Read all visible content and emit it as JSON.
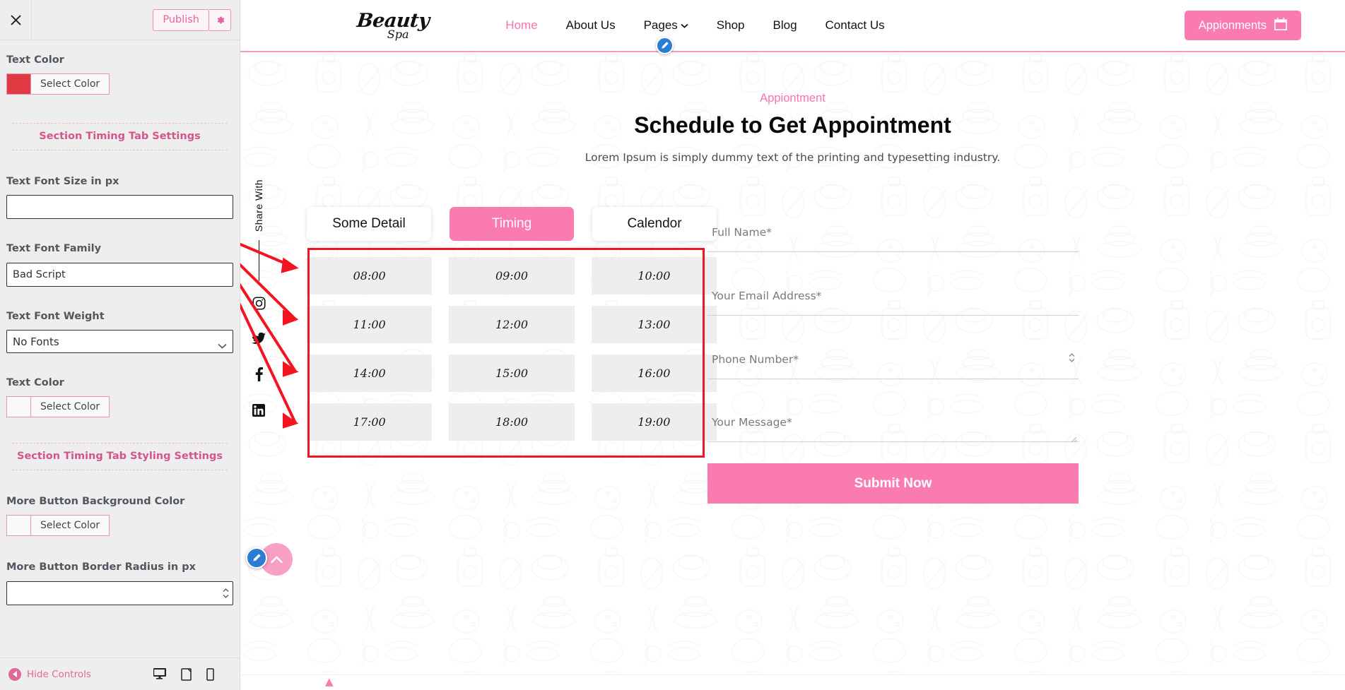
{
  "sidebar": {
    "close_icon": "close-icon",
    "publish_label": "Publish",
    "gear_icon": "gear-icon",
    "controls": [
      {
        "type": "color",
        "label": "Text Color",
        "swatch": "#e03a43",
        "button": "Select Color"
      },
      {
        "type": "divider",
        "label": "Section Timing Tab Settings"
      },
      {
        "type": "text",
        "label": "Text Font Size in px",
        "value": "",
        "placeholder": ""
      },
      {
        "type": "text",
        "label": "Text Font Family",
        "value": "Bad Script",
        "placeholder": ""
      },
      {
        "type": "select",
        "label": "Text Font Weight",
        "value": "No Fonts"
      },
      {
        "type": "color",
        "label": "Text Color",
        "swatch": "#fafafa",
        "button": "Select Color"
      },
      {
        "type": "divider",
        "label": "Section Timing Tab Styling Settings"
      },
      {
        "type": "color",
        "label": "More Button Background Color",
        "swatch": "#fafafa",
        "button": "Select Color"
      },
      {
        "type": "number",
        "label": "More Button Border Radius in px",
        "value": "",
        "placeholder": ""
      }
    ],
    "footer": {
      "hide_controls": "Hide Controls",
      "devices": [
        "desktop-icon",
        "tablet-icon",
        "mobile-icon"
      ]
    }
  },
  "site": {
    "logo": {
      "line1": "Beauty",
      "line2": "Spa"
    },
    "nav": [
      {
        "label": "Home",
        "active": true,
        "caret": false
      },
      {
        "label": "About Us",
        "active": false,
        "caret": false
      },
      {
        "label": "Pages",
        "active": false,
        "caret": true
      },
      {
        "label": "Shop",
        "active": false,
        "caret": false
      },
      {
        "label": "Blog",
        "active": false,
        "caret": false
      },
      {
        "label": "Contact Us",
        "active": false,
        "caret": false
      }
    ],
    "appointment_button": {
      "label": "Appionments",
      "icon": "calendar-icon",
      "color": "#f97bb0"
    }
  },
  "hero": {
    "eyebrow": "Appiontment",
    "title": "Schedule to Get Appointment",
    "text": "Lorem Ipsum is simply dummy text of the printing and typesetting industry."
  },
  "share": {
    "label": "Share With",
    "icons": [
      "instagram-icon",
      "twitter-icon",
      "facebook-icon",
      "linkedin-icon"
    ]
  },
  "booking": {
    "tabs": [
      {
        "label": "Some Detail",
        "active": false
      },
      {
        "label": "Timing",
        "active": true
      },
      {
        "label": "Calendor",
        "active": false
      }
    ],
    "slots": [
      "08:00",
      "09:00",
      "10:00",
      "11:00",
      "12:00",
      "13:00",
      "14:00",
      "15:00",
      "16:00",
      "17:00",
      "18:00",
      "19:00"
    ]
  },
  "form": {
    "fields": [
      {
        "name": "full-name",
        "placeholder": "Full Name*",
        "value": ""
      },
      {
        "name": "email",
        "placeholder": "Your Email Address*",
        "value": ""
      },
      {
        "name": "phone",
        "placeholder": "Phone Number*",
        "value": ""
      },
      {
        "name": "message",
        "placeholder": "Your Message*",
        "value": ""
      }
    ],
    "submit_label": "Submit Now"
  },
  "annotation": {
    "color": "#f41421",
    "arrow_count": 4
  }
}
